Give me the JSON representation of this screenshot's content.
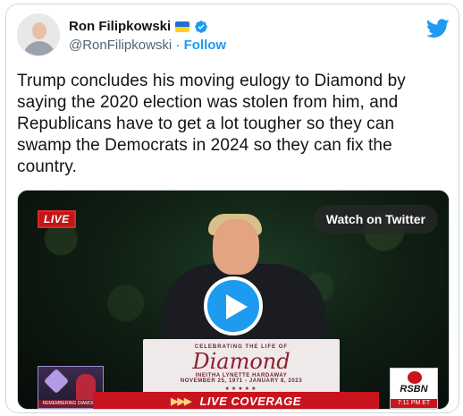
{
  "author": {
    "display_name": "Ron Filipkowski",
    "handle": "@RonFilipkowski",
    "separator": "·",
    "follow_label": "Follow"
  },
  "tweet": {
    "text_lines": [
      "Trump concludes his moving eulogy to Diamond by",
      "saying the 2020 election was stolen from him, and",
      "Republicans have to get a lot tougher so they can",
      "swamp the Democrats in 2024 so they can fix the",
      "country."
    ]
  },
  "video": {
    "live_label": "LIVE",
    "watch_label": "Watch on Twitter",
    "podium_line1": "CELEBRATING THE LIFE OF",
    "podium_name": "Diamond",
    "podium_fullname": "INEITHA LYNETTE HARDAWAY",
    "podium_dates": "NOVEMBER 25, 1971 - JANUARY 8, 2023",
    "lower_third": "LIVE COVERAGE",
    "lower_arrows": "▶▶▶",
    "inset_caption": "REMEMBERING DIAMOND",
    "network": "RSBN",
    "time": "7:11 PM  ET"
  },
  "colors": {
    "twitter_blue": "#1d9bf0",
    "live_red": "#c41515",
    "secondary_text": "#536471"
  }
}
